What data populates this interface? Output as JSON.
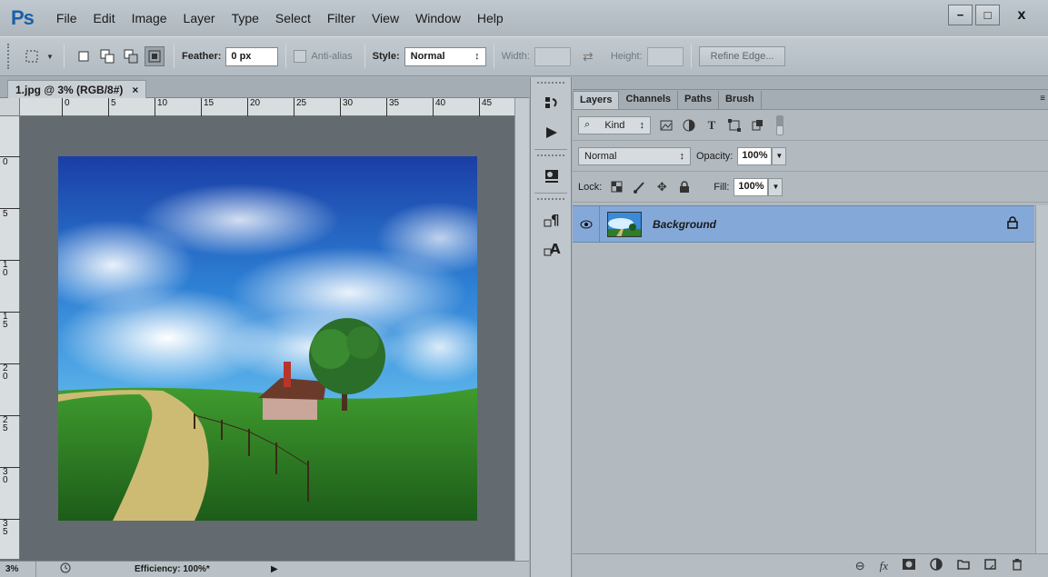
{
  "app": {
    "logo": "Ps"
  },
  "menu": [
    "File",
    "Edit",
    "Image",
    "Layer",
    "Type",
    "Select",
    "Filter",
    "View",
    "Window",
    "Help"
  ],
  "window_controls": {
    "minimize": "−",
    "maximize": "□",
    "close": "x"
  },
  "options": {
    "feather_label": "Feather:",
    "feather_value": "0 px",
    "antialias_label": "Anti-alias",
    "style_label": "Style:",
    "style_value": "Normal",
    "width_label": "Width:",
    "height_label": "Height:",
    "refine_edge": "Refine Edge..."
  },
  "document": {
    "tab_title": "1.jpg @ 3% (RGB/8#)",
    "close": "×",
    "ruler_h": [
      "0",
      "5",
      "10",
      "15",
      "20",
      "25",
      "30",
      "35",
      "40",
      "45"
    ],
    "ruler_v": [
      "0",
      "5",
      "1\n0",
      "1\n5",
      "2\n0",
      "2\n5",
      "3\n0",
      "3\n5"
    ]
  },
  "status": {
    "zoom": "3%",
    "efficiency": "Efficiency: 100%*",
    "arrow": "▶"
  },
  "panel": {
    "tabs": [
      "Layers",
      "Channels",
      "Paths",
      "Brush"
    ],
    "active_tab": "Layers",
    "kind_label": "Kind",
    "blend_mode": "Normal",
    "opacity_label": "Opacity:",
    "opacity_value": "100%",
    "lock_label": "Lock:",
    "fill_label": "Fill:",
    "fill_value": "100%",
    "layer_name": "Background"
  },
  "colors": {
    "accent": "#1b5fa8",
    "selected_layer": "#84a9d9"
  }
}
